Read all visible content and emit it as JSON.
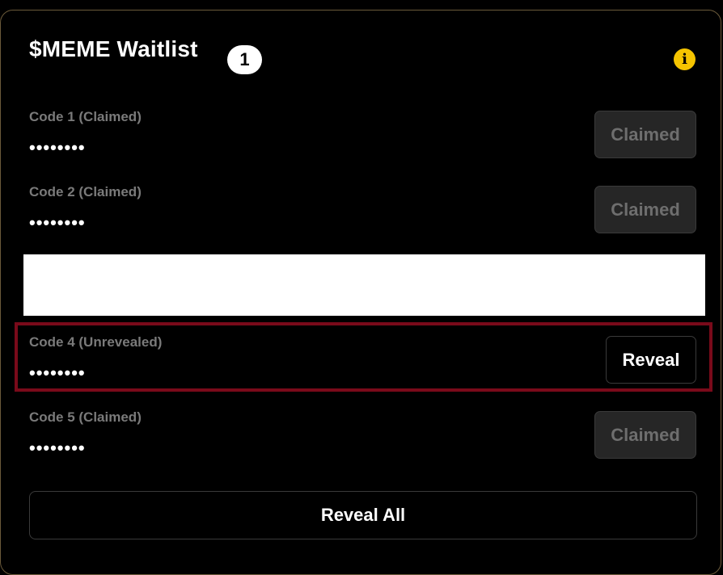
{
  "header": {
    "title": "$MEME Waitlist",
    "count": "1",
    "info_icon": "i"
  },
  "codes": [
    {
      "label": "Code 1 (Claimed)",
      "masked": "••••••••",
      "button": "Claimed",
      "state": "claimed"
    },
    {
      "label": "Code 2 (Claimed)",
      "masked": "••••••••",
      "button": "Claimed",
      "state": "claimed"
    },
    {
      "label": "",
      "masked": "",
      "button": "",
      "state": "redacted"
    },
    {
      "label": "Code 4 (Unrevealed)",
      "masked": "••••••••",
      "button": "Reveal",
      "state": "unrevealed"
    },
    {
      "label": "Code 5 (Claimed)",
      "masked": "••••••••",
      "button": "Claimed",
      "state": "claimed"
    }
  ],
  "footer": {
    "reveal_all_label": "Reveal All"
  },
  "colors": {
    "accent_info": "#f5c400",
    "highlight_border": "#7a0a1a",
    "claimed_bg": "#262626"
  }
}
